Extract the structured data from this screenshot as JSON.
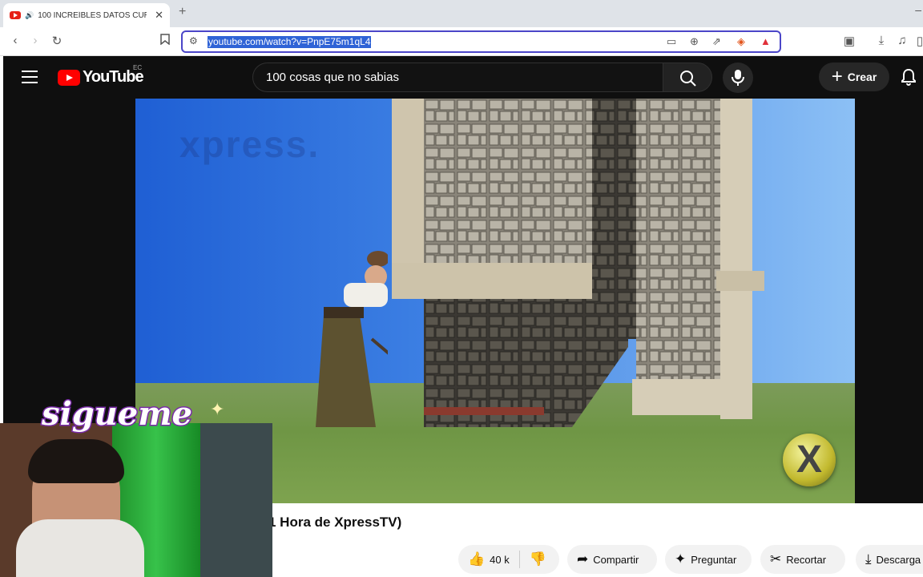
{
  "browser": {
    "tab_title": "100 INCREÍBLES DATOS CURI",
    "tab_close": "✕",
    "new_tab": "+",
    "url": "youtube.com/watch?v=PnpE75m1qL4"
  },
  "youtube": {
    "region": "EC",
    "logo_text": "YouTube",
    "search_query": "100 cosas que no sabias",
    "create_label": "Crear"
  },
  "video": {
    "watermark": "xpress.",
    "close_glyph": "X",
    "title": "1 Hora de XpressTV)"
  },
  "actions": {
    "likes": "40 k",
    "share": "Compartir",
    "ask": "Preguntar",
    "clip": "Recortar",
    "download": "Descarga"
  },
  "overlay": {
    "sigueme": "sigueme"
  },
  "colors": {
    "yt_red": "#ff0000",
    "url_highlight": "#2f63d6",
    "omnibox_border": "#4b46c8"
  }
}
